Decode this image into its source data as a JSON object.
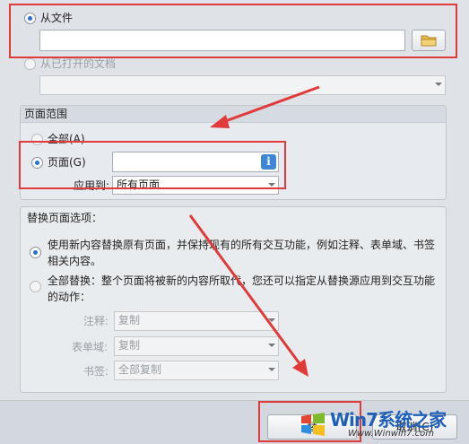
{
  "source": {
    "from_file_label": "从文件",
    "from_file_value": "",
    "from_open_doc_label": "从已打开的文档",
    "open_doc_value": ""
  },
  "page_range": {
    "title": "页面范围",
    "all_label": "全部(A)",
    "pages_label": "页面(G)",
    "pages_value": "",
    "apply_to_label": "应用到:",
    "apply_to_value": "所有页面"
  },
  "replace_options": {
    "title": "替换页面选项：",
    "option1_text": "使用新内容替换原有页面，并保持现有的所有交互功能，例如注释、表单域、书签相关内容。",
    "option2_text": "全部替换：整个页面将被新的内容所取代，您还可以指定从替换源应用到交互功能的动作：",
    "annotation_label": "注释:",
    "annotation_value": "复制",
    "form_field_label": "表单域:",
    "form_field_value": "复制",
    "bookmark_label": "书签:",
    "bookmark_value": "全部复制"
  },
  "buttons": {
    "ok_label": "替",
    "cancel_label": "取消(C)"
  },
  "watermark": {
    "text": "Win7系统之家",
    "url": "Www.Winwin7.com"
  },
  "colors": {
    "annotation_red": "#e03a3a",
    "radio_blue": "#2c6fd6",
    "folder_yellow": "#e8b94a",
    "info_blue": "#3f86d6"
  }
}
